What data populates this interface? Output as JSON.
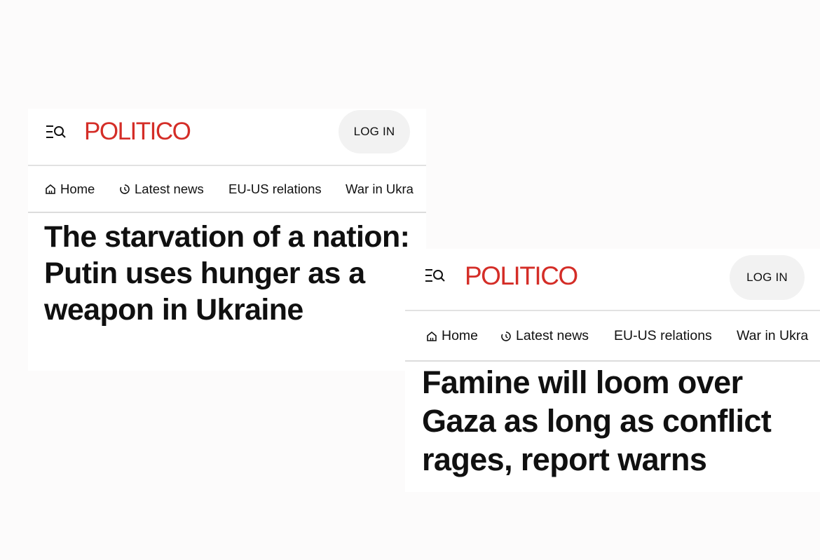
{
  "articles": [
    {
      "logo": "POLITICO",
      "login_label": "LOG IN",
      "nav": {
        "home": "Home",
        "latest": "Latest news",
        "euus": "EU-US relations",
        "war": "War in Ukra"
      },
      "headline": "The starvation of a nation: Putin uses hunger as a weapon in Ukraine"
    },
    {
      "logo": "POLITICO",
      "login_label": "LOG IN",
      "nav": {
        "home": "Home",
        "latest": "Latest news",
        "euus": "EU-US relations",
        "war": "War in Ukra"
      },
      "headline": "Famine will loom over Gaza as long as conflict rages, report warns"
    }
  ],
  "colors": {
    "brand": "#d42d27",
    "text": "#101010",
    "button_bg": "#f2f2f2"
  },
  "icons": [
    "menu-search-icon",
    "home-icon",
    "clock-icon"
  ]
}
